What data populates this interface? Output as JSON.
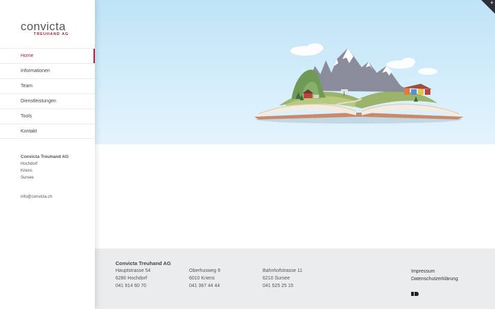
{
  "logo": {
    "brand": "convicta",
    "sub": "TREUHAND AG"
  },
  "nav": {
    "items": [
      {
        "label": "Home",
        "active": true
      },
      {
        "label": "Informationen"
      },
      {
        "label": "Team"
      },
      {
        "label": "Dienstleistungen"
      },
      {
        "label": "Tools"
      },
      {
        "label": "Kontakt"
      }
    ]
  },
  "sidebar_address": {
    "company": "Convicta Treuhand AG",
    "locations": [
      "Hochdorf",
      "Kriens",
      "Sursee"
    ],
    "email": "info@convicta.ch"
  },
  "hero": {
    "corner_icon": "plus-icon",
    "corner_symbol": "+",
    "illustration": "open-book-mountains-illustration"
  },
  "footer": {
    "company": "Convicta Treuhand AG",
    "offices": [
      {
        "street": "Hauptstrasse 54",
        "city": "6280 Hochdorf",
        "phone": "041 914 60 70"
      },
      {
        "street": "Oberhusweg 9",
        "city": "6010 Kriens",
        "phone": "041 367 44 44"
      },
      {
        "street": "Bahnhofstrasse 11",
        "city": "6210 Sursee",
        "phone": "041 525 25 15"
      }
    ],
    "links": [
      "Impressum",
      "Datenschutzerklärung"
    ],
    "credit_icon": "agency-logo-icon"
  },
  "colors": {
    "accent": "#a8233a",
    "hero_sky": "#bfe3f7",
    "footer_bg": "#ebeced"
  }
}
